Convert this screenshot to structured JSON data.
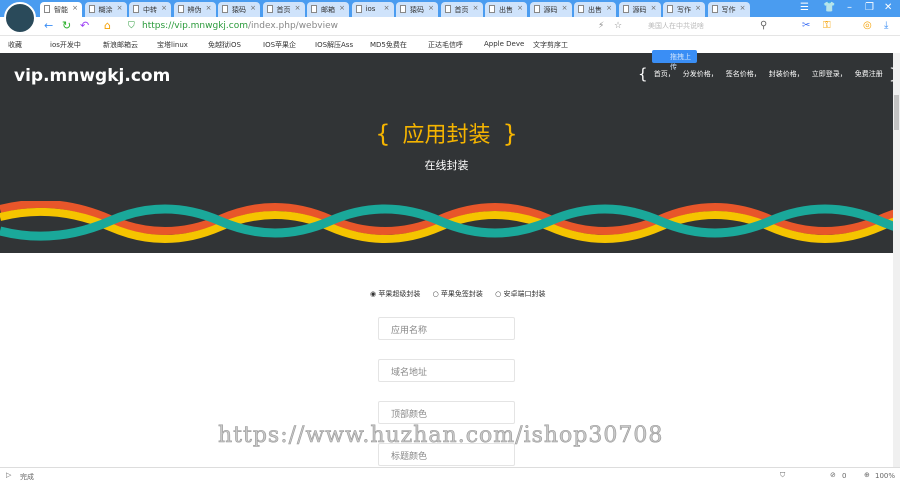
{
  "browser": {
    "tabs": [
      "智能",
      "糊涂",
      "中转",
      "辨伪",
      "猿码",
      "首页",
      "邮箱",
      "ios",
      "猿码",
      "首页",
      "出售",
      "源码",
      "出售",
      "源码",
      "写作",
      "写作"
    ],
    "url_prefix": "https://",
    "url_domain": "vip.mnwgkj.com",
    "url_path": "/index.php/webview",
    "search_placeholder": "美国人在中共说啥",
    "bookmarks": [
      "收藏",
      "ios开发中",
      "新浪邮箱云",
      "宝塔linux",
      "免越狱iOS",
      "IOS苹果企",
      "IOS解压Ass",
      "MD5免费在",
      "正达毛信呼",
      "Apple Deve",
      "文字剪序工"
    ],
    "upload_label": "拖拽上传",
    "status_text": "完成",
    "zoom": "100%",
    "block_count": "0"
  },
  "site": {
    "logo": "vip.mnwgkj.com",
    "nav": [
      "首页，",
      "分发价格，",
      "签名价格，",
      "封装价格，",
      "立即登录，",
      "免费注册"
    ],
    "brace_open": "{",
    "brace_close": "}",
    "title": "应用封装",
    "subtitle": "在线封装",
    "radios": [
      "苹果超级封装",
      "苹果免签封装",
      "安卓端口封装"
    ],
    "fields": [
      "应用名称",
      "域名地址",
      "顶部颜色",
      "标题颜色"
    ]
  },
  "watermark": "https://www.huzhan.com/ishop30708"
}
